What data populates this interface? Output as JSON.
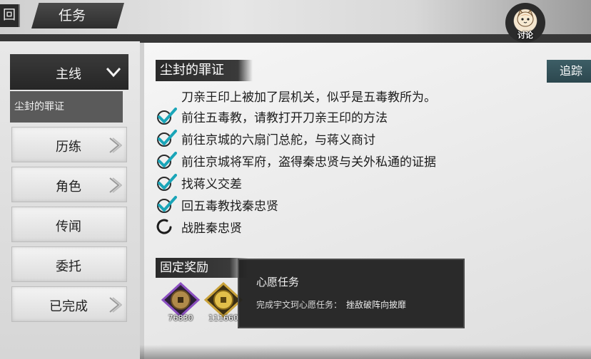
{
  "header": {
    "back_label": "回",
    "title": "任务",
    "discuss_label": "讨论"
  },
  "sidebar": {
    "main_category": "主线",
    "active_quest": "尘封的罪证",
    "items": [
      {
        "label": "历练",
        "has_arrow": true
      },
      {
        "label": "角色",
        "has_arrow": true
      },
      {
        "label": "传闻",
        "has_arrow": false
      },
      {
        "label": "委托",
        "has_arrow": false
      },
      {
        "label": "已完成",
        "has_arrow": true
      }
    ]
  },
  "quest": {
    "title": "尘封的罪证",
    "track_label": "追踪",
    "description": "刀亲王印上被加了层机关，似乎是五毒教所为。",
    "tasks": [
      {
        "text": "前往五毒教，请教打开刀亲王印的方法",
        "status": "done"
      },
      {
        "text": "前往京城的六扇门总舵，与蒋义商讨",
        "status": "done"
      },
      {
        "text": "前往京城将军府，盗得秦忠贤与关外私通的证据",
        "status": "done"
      },
      {
        "text": "找蒋义交差",
        "status": "done"
      },
      {
        "text": "回五毒教找秦忠贤",
        "status": "done"
      },
      {
        "text": "战胜秦忠贤",
        "status": "in-progress"
      }
    ]
  },
  "rewards": {
    "title": "固定奖励",
    "items": [
      {
        "icon": "copper-coin-icon",
        "amount": "76830",
        "border_color": "#8a4fc0"
      },
      {
        "icon": "gold-coin-icon",
        "amount": "111660",
        "border_color": "#c9a23a"
      }
    ]
  },
  "tooltip": {
    "title": "心愿任务",
    "body": "完成宇文珂心愿任务：",
    "target": "挫敌破阵向披靡"
  },
  "colors": {
    "accent_track": "#2c474e",
    "check_teal": "#1aa5b8",
    "panel_dark": "#2a2a2a"
  }
}
